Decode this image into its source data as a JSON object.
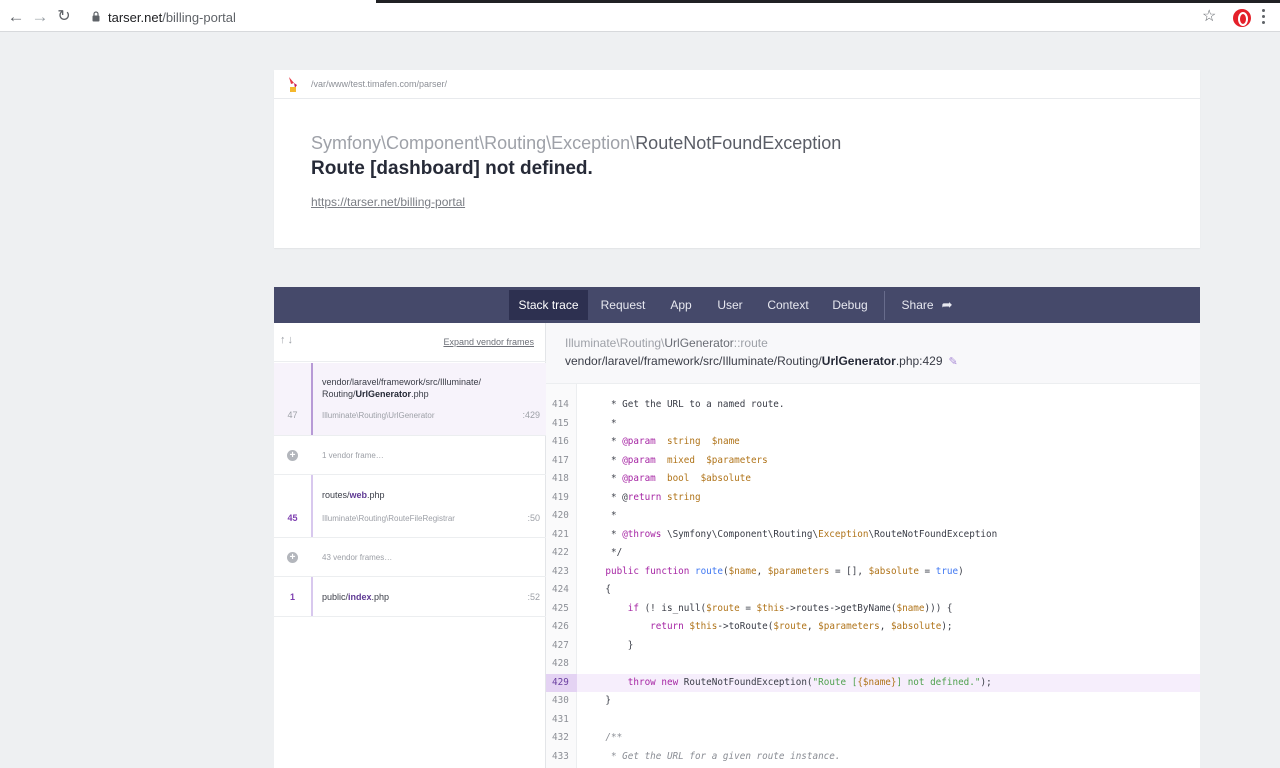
{
  "browser": {
    "url_host": "tarser.net",
    "url_path": "/billing-portal",
    "icons": [
      "back-icon",
      "forward-icon",
      "reload-icon",
      "lock-icon",
      "star-icon",
      "opera-icon",
      "menu-icon"
    ]
  },
  "header": {
    "app_path": "/var/www/test.timafen.com/parser/",
    "exception_namespace": "Symfony\\Component\\Routing\\Exception\\",
    "exception_class": "RouteNotFoundException",
    "message": "Route [dashboard] not defined.",
    "request_url": "https://tarser.net/billing-portal"
  },
  "tabs": [
    {
      "label": "Stack trace",
      "active": true
    },
    {
      "label": "Request"
    },
    {
      "label": "App"
    },
    {
      "label": "User"
    },
    {
      "label": "Context"
    },
    {
      "label": "Debug"
    },
    {
      "label": "Share"
    }
  ],
  "frames": {
    "expand_label": "Expand vendor frames",
    "items": [
      {
        "number": "47",
        "file_prefix": "vendor/laravel/framework/src/Illuminate/",
        "file_mid": "Routing/",
        "file_name": "UrlGenerator",
        "file_ext": ".php",
        "class": "Illuminate\\Routing\\UrlGenerator",
        "line": ":429"
      },
      {
        "collapsed": "1 vendor frame…"
      },
      {
        "number": "45",
        "file_prefix": "routes/",
        "file_name": "web",
        "file_ext": ".php",
        "class": "Illuminate\\Routing\\RouteFileRegistrar",
        "line": ":50"
      },
      {
        "collapsed": "43 vendor frames…"
      },
      {
        "number": "1",
        "file_prefix": "public/",
        "file_name": "index",
        "file_ext": ".php",
        "line": ":52"
      }
    ]
  },
  "code_header": {
    "class_prefix": "Illuminate\\Routing\\",
    "class_name": "UrlGenerator",
    "method": "::route",
    "file_prefix": "vendor/laravel/framework/src/Illuminate/Routing/",
    "file_name": "UrlGenerator",
    "file_suffix": ".php:429"
  },
  "code_lines": [
    {
      "n": "414",
      "text": "     * Get the URL to a named route."
    },
    {
      "n": "415",
      "text": "     *"
    },
    {
      "n": "416",
      "text": "     * @param  string  $name"
    },
    {
      "n": "417",
      "text": "     * @param  mixed  $parameters"
    },
    {
      "n": "418",
      "text": "     * @param  bool  $absolute"
    },
    {
      "n": "419",
      "text": "     * @return string"
    },
    {
      "n": "420",
      "text": "     *"
    },
    {
      "n": "421",
      "text": "     * @throws \\Symfony\\Component\\Routing\\Exception\\RouteNotFoundException"
    },
    {
      "n": "422",
      "text": "     */"
    },
    {
      "n": "423",
      "text": "    public function route($name, $parameters = [], $absolute = true)"
    },
    {
      "n": "424",
      "text": "    {"
    },
    {
      "n": "425",
      "text": "        if (! is_null($route = $this->routes->getByName($name))) {"
    },
    {
      "n": "426",
      "text": "            return $this->toRoute($route, $parameters, $absolute);"
    },
    {
      "n": "427",
      "text": "        }"
    },
    {
      "n": "428",
      "text": ""
    },
    {
      "n": "429",
      "text": "        throw new RouteNotFoundException(\"Route [{$name}] not defined.\");"
    },
    {
      "n": "430",
      "text": "    }"
    },
    {
      "n": "431",
      "text": ""
    },
    {
      "n": "432",
      "text": "    /**"
    },
    {
      "n": "433",
      "text": "     * Get the URL for a given route instance."
    }
  ],
  "highlight_line": "429",
  "colors": {
    "tab_bar": "#45496a",
    "active_tab": "#2d3050",
    "accent": "#7e3fb0"
  }
}
